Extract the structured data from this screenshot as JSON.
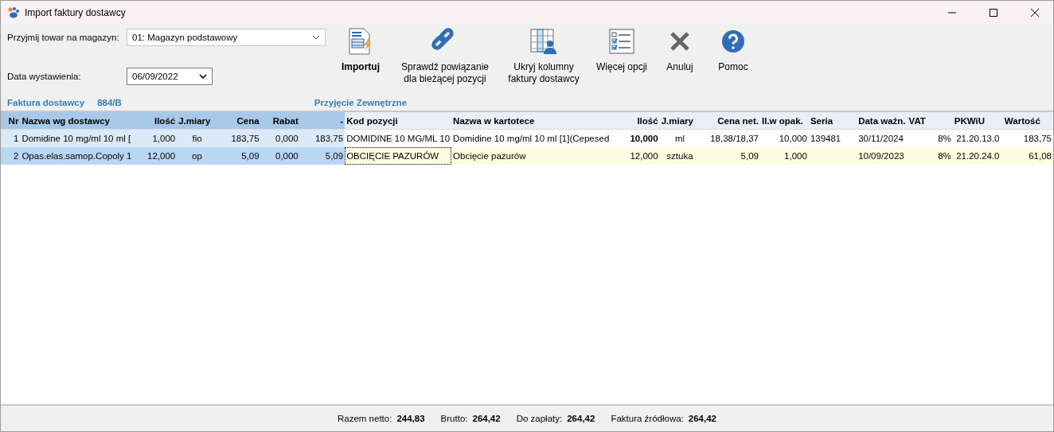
{
  "window": {
    "title": "Import faktury dostawcy"
  },
  "form": {
    "warehouse_label": "Przyjmij towar na magazyn:",
    "warehouse_value": "01: Magazyn podstawowy",
    "date_label": "Data wystawienia:",
    "date_value": "06/09/2022"
  },
  "toolbar": [
    {
      "kind": "import",
      "label": "Importuj",
      "bold": true
    },
    {
      "kind": "link",
      "label": "Sprawdź powiązanie\ndla bieżącej pozycji",
      "bold": false
    },
    {
      "kind": "columns",
      "label": "Ukryj kolumny\nfaktury dostawcy",
      "bold": false
    },
    {
      "kind": "options",
      "label": "Więcej opcji",
      "bold": false
    },
    {
      "kind": "cancel",
      "label": "Anuluj",
      "bold": false
    },
    {
      "kind": "help",
      "label": "Pomoc",
      "bold": false
    }
  ],
  "invoice": {
    "label": "Faktura dostawcy",
    "number": "884/B",
    "doc_type": "Przyjęcie Zewnętrzne"
  },
  "table": {
    "supplier_columns": [
      "Nr",
      "Nazwa wg dostawcy",
      "Ilość",
      "J.miary",
      "Cena",
      "Rabat",
      "-"
    ],
    "stock_columns": [
      "Kod pozycji",
      "Nazwa w kartotece",
      "Ilość",
      "J.miary",
      "Cena net.",
      "Il.w opak.",
      "Seria",
      "Data ważn.",
      "VAT",
      "PKWiU",
      "Wartość"
    ],
    "rows": [
      {
        "selected": false,
        "qty_bold": true,
        "supplier": [
          "1",
          "Domidine 10 mg/ml 10 ml [",
          "1,000",
          "fio",
          "183,75",
          "0,000",
          "183,75"
        ],
        "stock": {
          "code": "DOMIDINE 10 MG/ML 10",
          "name": "Domidine 10 mg/ml 10 ml [1](Cepesed",
          "qty": "10,000",
          "unit": "ml",
          "net_price": "18,38/18,37",
          "pack_qty": "10,000",
          "batch": "139481",
          "expiry": "30/11/2024",
          "vat": "8%",
          "pkwiu": "21.20.13.0",
          "value": "183,75"
        }
      },
      {
        "selected": true,
        "qty_bold": false,
        "supplier": [
          "2",
          "Opas.elas.samop.Copoly 1",
          "12,000",
          "op",
          "5,09",
          "0,000",
          "5,09"
        ],
        "stock": {
          "code": "OBCIĘCIE PAZURÓW",
          "name": "Obcięcie pazurów",
          "qty": "12,000",
          "unit": "sztuka",
          "net_price": "5,09",
          "pack_qty": "1,000",
          "expiry": "10/09/2023",
          "vat": "8%",
          "pkwiu": "21.20.24.0",
          "value": "61,08"
        }
      }
    ]
  },
  "totals": [
    {
      "label": "Razem netto:",
      "value": "244,83"
    },
    {
      "label": "Brutto:",
      "value": "264,42"
    },
    {
      "label": "Do zapłaty:",
      "value": "264,42"
    },
    {
      "label": "Faktura źródłowa:",
      "value": "264,42"
    }
  ]
}
